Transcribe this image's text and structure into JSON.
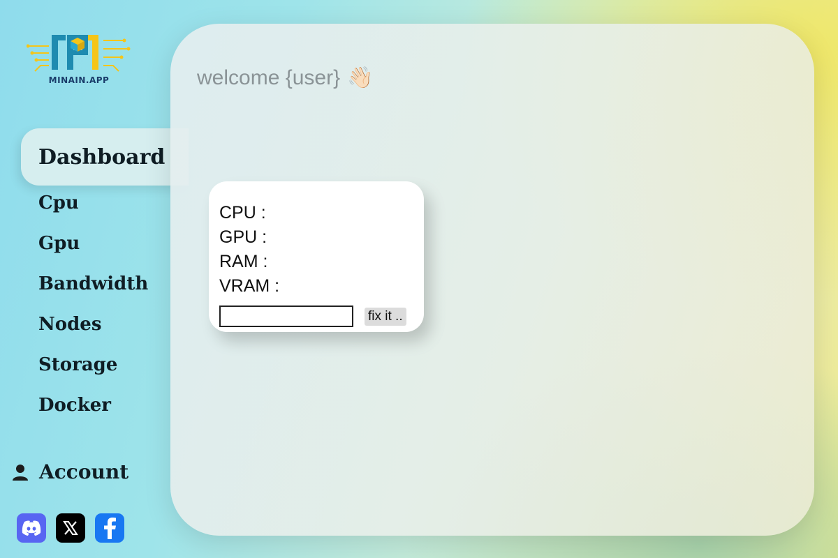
{
  "brand": {
    "logo_caption": "MINAIN.APP"
  },
  "sidebar": {
    "items": [
      {
        "label": "Dashboard",
        "active": true
      },
      {
        "label": "Cpu"
      },
      {
        "label": "Gpu"
      },
      {
        "label": "Bandwidth"
      },
      {
        "label": "Nodes"
      },
      {
        "label": "Storage"
      },
      {
        "label": "Docker"
      }
    ],
    "account": {
      "label": "Account",
      "icon": "user-icon"
    },
    "socials": [
      {
        "name": "discord",
        "icon": "discord-icon",
        "color": "#5865f2"
      },
      {
        "name": "x",
        "icon": "x-icon",
        "color": "#000000"
      },
      {
        "name": "facebook",
        "icon": "facebook-icon",
        "color": "#1877f2"
      }
    ]
  },
  "main": {
    "welcome_text": "welcome {user}",
    "welcome_emoji": "👋🏻",
    "stats_card": {
      "lines": [
        "CPU :",
        "GPU :",
        "RAM :",
        "VRAM :"
      ],
      "input_value": "",
      "button_label": "fix it .."
    }
  },
  "colors": {
    "active_nav_bg": "#d6eeef",
    "logo_primary": "#1e8bb0",
    "logo_accent": "#f5c518"
  }
}
